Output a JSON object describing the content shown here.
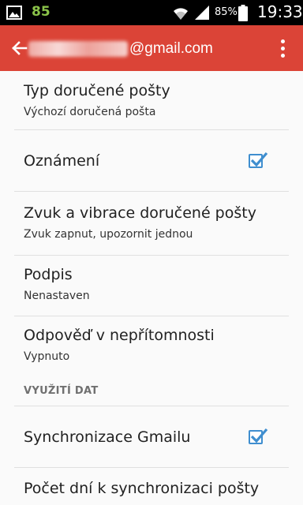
{
  "status_bar": {
    "notification_count": "85",
    "battery_percent": "85%",
    "time": "19:33"
  },
  "app_bar": {
    "title_suffix": "@gmail.com",
    "back_icon": "arrow-back-icon",
    "menu_icon": "overflow-menu-icon"
  },
  "settings": {
    "inbox_type": {
      "title": "Typ doručené pošty",
      "summary": "Výchozí doručená pošta"
    },
    "notifications": {
      "title": "Oznámení",
      "checked": true
    },
    "sound_vibration": {
      "title": "Zvuk a vibrace doručené pošty",
      "summary": "Zvuk zapnut, upozornit jednou"
    },
    "signature": {
      "title": "Podpis",
      "summary": "Nenastaven"
    },
    "vacation": {
      "title": "Odpověď v nepřítomnosti",
      "summary": "Vypnuto"
    },
    "data_section_header": "VYUŽITÍ DAT",
    "sync_gmail": {
      "title": "Synchronizace Gmailu",
      "checked": true
    },
    "sync_days": {
      "title": "Počet dní k synchronizaci pošty"
    }
  },
  "colors": {
    "app_bar": "#db4437",
    "checkbox": "#3f8ecf",
    "status_bar": "#000000"
  }
}
